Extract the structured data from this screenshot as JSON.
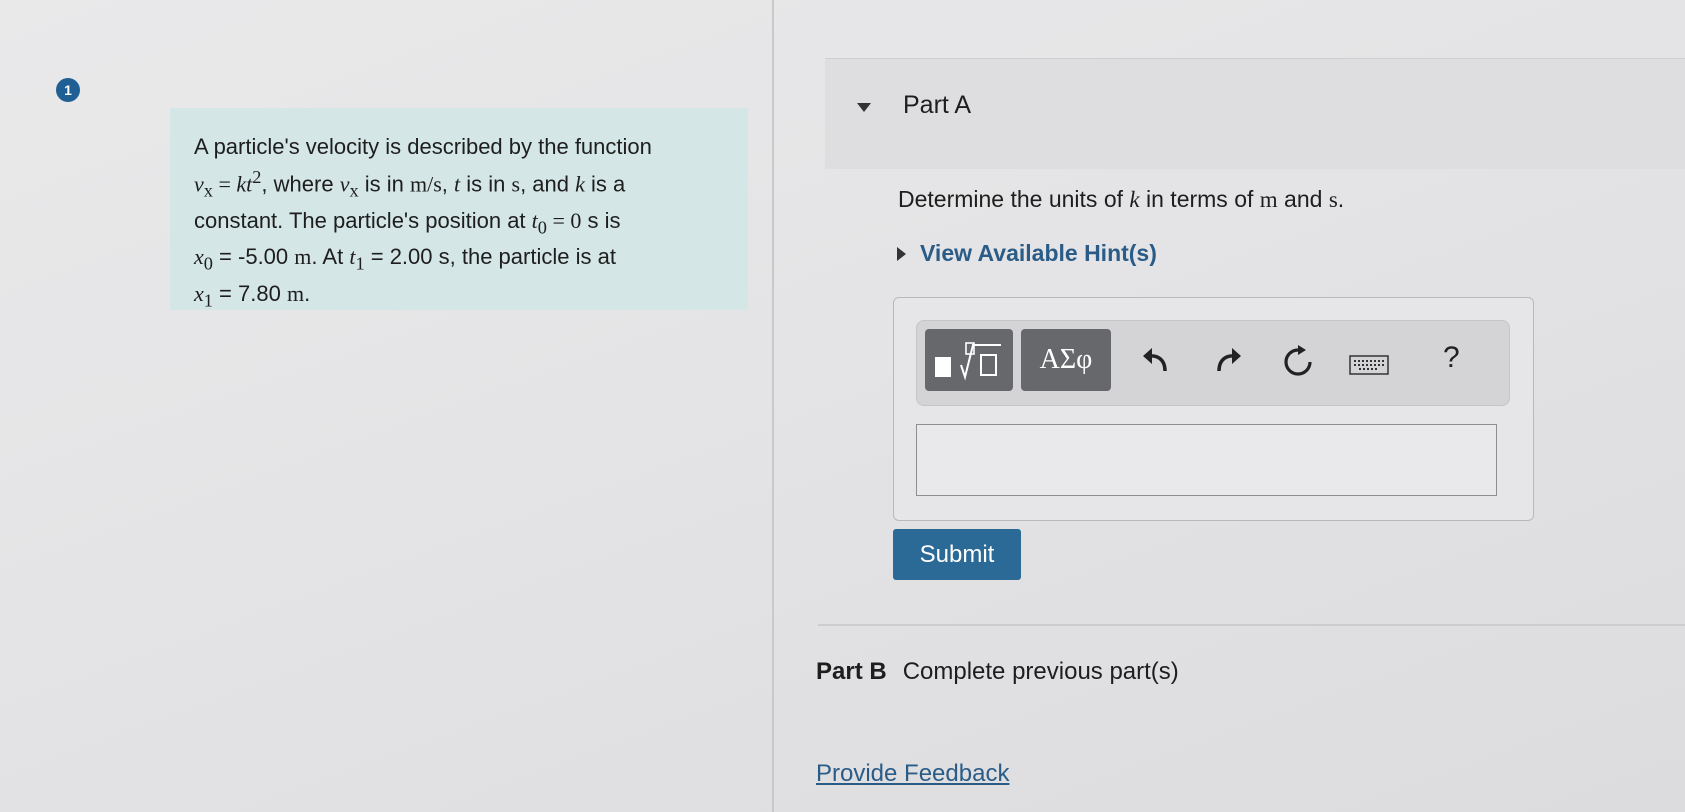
{
  "problem": {
    "number": "1",
    "line1": "A particle's velocity is described by the function",
    "line2": {
      "eq_lhs": "v",
      "eq_lhs_sub": "x",
      "eq_eq": " = ",
      "eq_rhs": "kt",
      "eq_rhs_sup": "2",
      "t1": ", where ",
      "v": "v",
      "v_sub": "x",
      "t2": " is in ",
      "unit_ms": "m/s",
      "t3": ", ",
      "t_var": "t",
      "t4": " is in ",
      "unit_s": "s",
      "t5": ", and ",
      "k_var": "k",
      "t6": " is a"
    },
    "line3": {
      "t1": "constant. The particle's position at ",
      "t0": "t",
      "t0_sub": "0",
      "eq": " = 0",
      "t2": " s is"
    },
    "line4": {
      "x0": "x",
      "x0_sub": "0",
      "t1": " = -5.00 ",
      "m": "m",
      "t2": ". At ",
      "t1v": "t",
      "t1v_sub": "1",
      "t3": " = 2.00 s, the particle is at"
    },
    "line5": {
      "x1": "x",
      "x1_sub": "1",
      "t1": " = 7.80 ",
      "m": "m",
      "t2": "."
    }
  },
  "partA": {
    "title": "Part A",
    "question": {
      "t1": "Determine the units of ",
      "k": "k",
      "t2": " in terms of ",
      "m": "m",
      "t3": " and ",
      "s": "s",
      "t4": "."
    },
    "hints": "View Available Hint(s)",
    "toolbar": {
      "greek": "ΑΣφ",
      "help": "?"
    },
    "submit": "Submit"
  },
  "partB": {
    "label": "Part B",
    "status": "Complete previous part(s)"
  },
  "feedback": "Provide Feedback",
  "colors": {
    "accent": "#2b6a96",
    "link": "#2b5c87",
    "problem_bg": "#d4e6e6",
    "badge": "#1f5f93"
  }
}
